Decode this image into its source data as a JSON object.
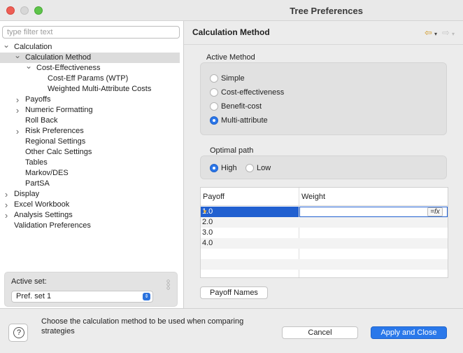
{
  "window": {
    "title": "Tree Preferences"
  },
  "filter": {
    "placeholder": "type filter text"
  },
  "tree": [
    {
      "label": "Calculation",
      "level": 0,
      "twisty": "expanded",
      "selected": false
    },
    {
      "label": "Calculation Method",
      "level": 1,
      "twisty": "expanded",
      "selected": true
    },
    {
      "label": "Cost-Effectiveness",
      "level": 2,
      "twisty": "expanded",
      "selected": false
    },
    {
      "label": "Cost-Eff Params (WTP)",
      "level": 3,
      "twisty": "none",
      "selected": false
    },
    {
      "label": "Weighted Multi-Attribute Costs",
      "level": 3,
      "twisty": "none",
      "selected": false
    },
    {
      "label": "Payoffs",
      "level": 1,
      "twisty": "collapsed",
      "selected": false
    },
    {
      "label": "Numeric Formatting",
      "level": 1,
      "twisty": "collapsed",
      "selected": false
    },
    {
      "label": "Roll Back",
      "level": 1,
      "twisty": "none",
      "selected": false
    },
    {
      "label": "Risk Preferences",
      "level": 1,
      "twisty": "collapsed",
      "selected": false
    },
    {
      "label": "Regional Settings",
      "level": 1,
      "twisty": "none",
      "selected": false
    },
    {
      "label": "Other Calc Settings",
      "level": 1,
      "twisty": "none",
      "selected": false
    },
    {
      "label": "Tables",
      "level": 1,
      "twisty": "none",
      "selected": false
    },
    {
      "label": "Markov/DES",
      "level": 1,
      "twisty": "none",
      "selected": false
    },
    {
      "label": "PartSA",
      "level": 1,
      "twisty": "none",
      "selected": false
    },
    {
      "label": "Display",
      "level": 0,
      "twisty": "collapsed",
      "selected": false
    },
    {
      "label": "Excel Workbook",
      "level": 0,
      "twisty": "collapsed",
      "selected": false
    },
    {
      "label": "Analysis Settings",
      "level": 0,
      "twisty": "collapsed",
      "selected": false
    },
    {
      "label": "Validation Preferences",
      "level": 0,
      "twisty": "none",
      "selected": false
    }
  ],
  "active_set": {
    "label": "Active set:",
    "value": "Pref. set 1"
  },
  "page": {
    "title": "Calculation Method"
  },
  "active_method": {
    "label": "Active Method",
    "options": [
      {
        "label": "Simple",
        "selected": false
      },
      {
        "label": "Cost-effectiveness",
        "selected": false
      },
      {
        "label": "Benefit-cost",
        "selected": false
      },
      {
        "label": "Multi-attribute",
        "selected": true
      }
    ]
  },
  "optimal_path": {
    "label": "Optimal path",
    "options": [
      {
        "label": "High",
        "selected": true
      },
      {
        "label": "Low",
        "selected": false
      }
    ]
  },
  "payoff_table": {
    "headers": [
      "Payoff",
      "Weight"
    ],
    "rows": [
      {
        "payoff": "1.0",
        "weight": ""
      },
      {
        "payoff": "2.0",
        "weight": ""
      },
      {
        "payoff": "3.0",
        "weight": ""
      },
      {
        "payoff": "4.0",
        "weight": ""
      }
    ],
    "fx_label": "=fx"
  },
  "buttons": {
    "payoff_names": "Payoff Names",
    "cancel": "Cancel",
    "apply_close": "Apply and Close"
  },
  "footer": {
    "description": "Choose the calculation method to be used when comparing strategies"
  },
  "colors": {
    "accent": "#2a78ea",
    "selection": "#2160d0",
    "tree_selection": "#dcdcdc"
  }
}
